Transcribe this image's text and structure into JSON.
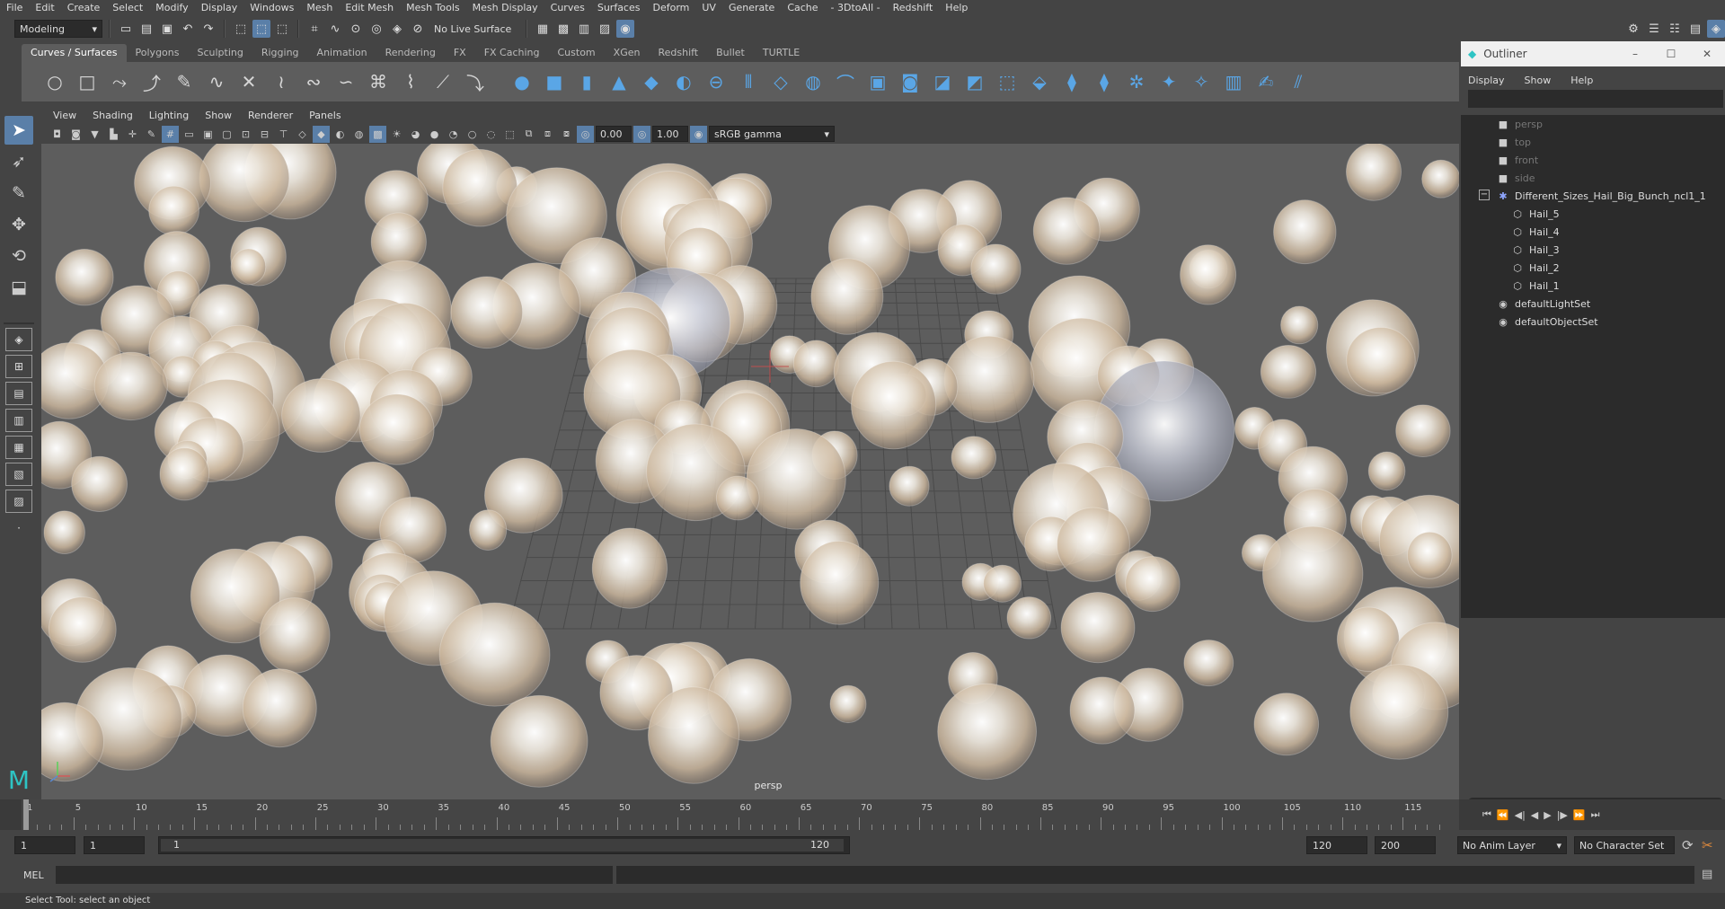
{
  "menubar": [
    "File",
    "Edit",
    "Create",
    "Select",
    "Modify",
    "Display",
    "Windows",
    "Mesh",
    "Edit Mesh",
    "Mesh Tools",
    "Mesh Display",
    "Curves",
    "Surfaces",
    "Deform",
    "UV",
    "Generate",
    "Cache",
    "- 3DtoAll -",
    "Redshift",
    "Help"
  ],
  "status": {
    "mode": "Modeling",
    "live_surface": "No Live Surface"
  },
  "shelf_tabs": [
    "Curves / Surfaces",
    "Polygons",
    "Sculpting",
    "Rigging",
    "Animation",
    "Rendering",
    "FX",
    "FX Caching",
    "Custom",
    "XGen",
    "Redshift",
    "Bullet",
    "TURTLE"
  ],
  "viewport": {
    "menu": [
      "View",
      "Shading",
      "Lighting",
      "Show",
      "Renderer",
      "Panels"
    ],
    "exposure": "0.00",
    "gamma": "1.00",
    "color_space": "sRGB gamma",
    "camera_label": "persp",
    "grid_color": "#4a4a4a",
    "hail_color": "#e9e2d6"
  },
  "outliner": {
    "title": "Outliner",
    "menu": [
      "Display",
      "Show",
      "Help"
    ],
    "items": [
      {
        "label": "persp",
        "icon": "camera-icon",
        "dim": true
      },
      {
        "label": "top",
        "icon": "camera-icon",
        "dim": true
      },
      {
        "label": "front",
        "icon": "camera-icon",
        "dim": true
      },
      {
        "label": "side",
        "icon": "camera-icon",
        "dim": true
      },
      {
        "label": "Different_Sizes_Hail_Big_Bunch_ncl1_1",
        "icon": "group-icon",
        "dim": false
      },
      {
        "label": "Hail_5",
        "icon": "mesh-icon",
        "dim": false
      },
      {
        "label": "Hail_4",
        "icon": "mesh-icon",
        "dim": false
      },
      {
        "label": "Hail_3",
        "icon": "mesh-icon",
        "dim": false
      },
      {
        "label": "Hail_2",
        "icon": "mesh-icon",
        "dim": false
      },
      {
        "label": "Hail_1",
        "icon": "mesh-icon",
        "dim": false
      },
      {
        "label": "defaultLightSet",
        "icon": "set-icon",
        "dim": false
      },
      {
        "label": "defaultObjectSet",
        "icon": "set-icon",
        "dim": false
      }
    ]
  },
  "timeline": {
    "ticks": [
      "1",
      "5",
      "10",
      "15",
      "20",
      "25",
      "30",
      "35",
      "40",
      "45",
      "50",
      "55",
      "60",
      "65",
      "70",
      "75",
      "80",
      "85",
      "90",
      "95",
      "100",
      "105",
      "110",
      "115"
    ],
    "current": "1"
  },
  "range": {
    "start": "1",
    "inner_start": "1",
    "slider_start": "1",
    "slider_end": "120",
    "inner_end": "120",
    "end": "200",
    "anim_layer": "No Anim Layer",
    "char_set": "No Character Set"
  },
  "cmd": {
    "label": "MEL"
  },
  "help": {
    "text": "Select Tool: select an object"
  }
}
